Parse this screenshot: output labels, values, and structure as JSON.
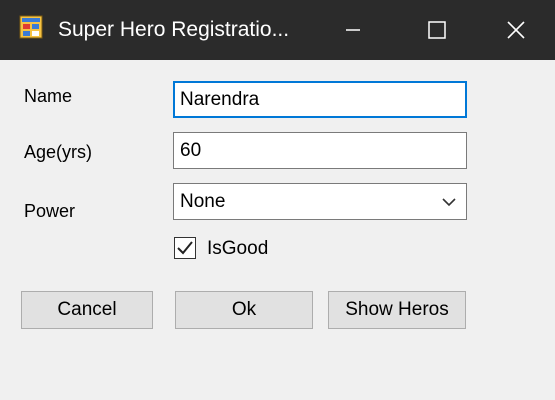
{
  "window": {
    "title": "Super Hero Registratio...",
    "icon": "app-window-icon",
    "controls": {
      "minimize": "minimize-icon",
      "maximize": "maximize-icon",
      "close": "close-icon"
    }
  },
  "form": {
    "name_label": "Name",
    "name_value": "Narendra",
    "age_label": "Age(yrs)",
    "age_value": "60",
    "power_label": "Power",
    "power_selected": "None",
    "isgood_label": "IsGood",
    "isgood_checked": true
  },
  "buttons": {
    "cancel": "Cancel",
    "ok": "Ok",
    "show_heros": "Show Heros"
  },
  "colors": {
    "titlebar": "#2b2b2b",
    "focus_border": "#0078d7",
    "button_face": "#e1e1e1"
  }
}
